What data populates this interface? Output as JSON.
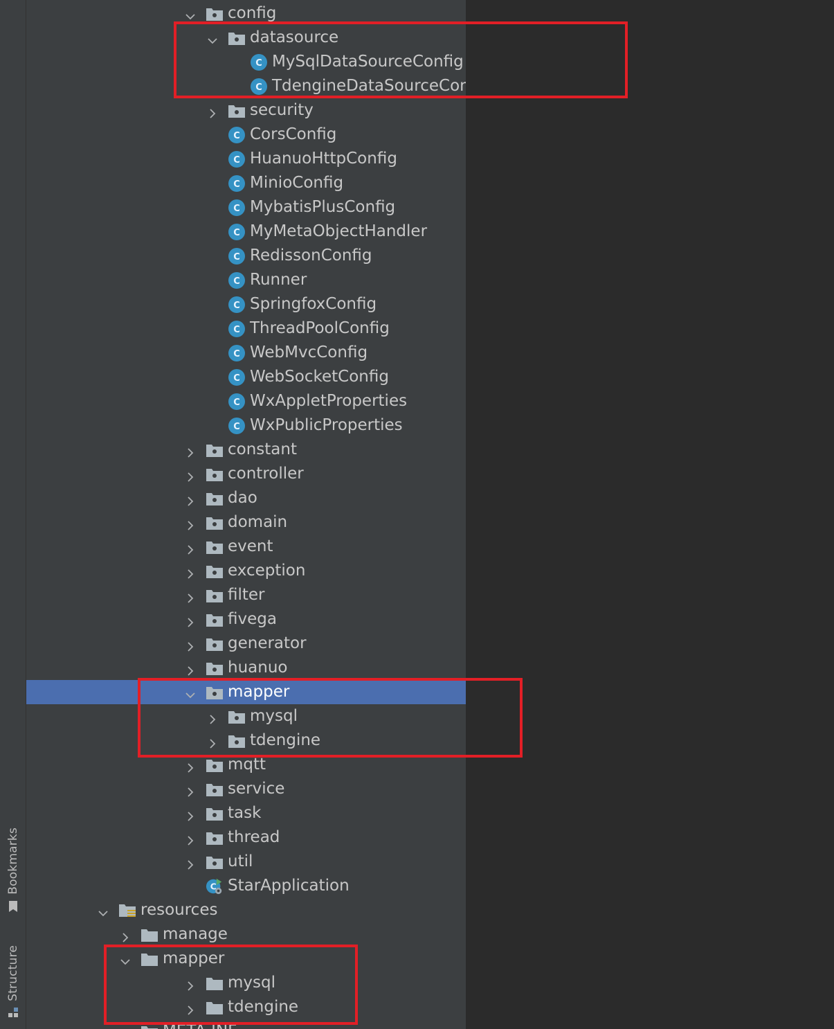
{
  "stripe": {
    "bookmarks_label": "Bookmarks",
    "structure_label": "Structure"
  },
  "tree": [
    {
      "label": "config",
      "type": "package",
      "expanded": true
    },
    {
      "label": "datasource",
      "type": "package",
      "expanded": true
    },
    {
      "label": "MySqlDataSourceConfig",
      "type": "class"
    },
    {
      "label": "TdengineDataSourceConfig",
      "type": "class"
    },
    {
      "label": "security",
      "type": "package",
      "expanded": false
    },
    {
      "label": "CorsConfig",
      "type": "class"
    },
    {
      "label": "HuanuoHttpConfig",
      "type": "class"
    },
    {
      "label": "MinioConfig",
      "type": "class"
    },
    {
      "label": "MybatisPlusConfig",
      "type": "class"
    },
    {
      "label": "MyMetaObjectHandler",
      "type": "class"
    },
    {
      "label": "RedissonConfig",
      "type": "class"
    },
    {
      "label": "Runner",
      "type": "class"
    },
    {
      "label": "SpringfoxConfig",
      "type": "class"
    },
    {
      "label": "ThreadPoolConfig",
      "type": "class"
    },
    {
      "label": "WebMvcConfig",
      "type": "class"
    },
    {
      "label": "WebSocketConfig",
      "type": "class"
    },
    {
      "label": "WxAppletProperties",
      "type": "class"
    },
    {
      "label": "WxPublicProperties",
      "type": "class"
    },
    {
      "label": "constant",
      "type": "package",
      "expanded": false
    },
    {
      "label": "controller",
      "type": "package",
      "expanded": false
    },
    {
      "label": "dao",
      "type": "package",
      "expanded": false
    },
    {
      "label": "domain",
      "type": "package",
      "expanded": false
    },
    {
      "label": "event",
      "type": "package",
      "expanded": false
    },
    {
      "label": "exception",
      "type": "package",
      "expanded": false
    },
    {
      "label": "filter",
      "type": "package",
      "expanded": false
    },
    {
      "label": "fivega",
      "type": "package",
      "expanded": false
    },
    {
      "label": "generator",
      "type": "package",
      "expanded": false
    },
    {
      "label": "huanuo",
      "type": "package",
      "expanded": false
    },
    {
      "label": "mapper",
      "type": "package",
      "expanded": true,
      "selected": true
    },
    {
      "label": "mysql",
      "type": "package",
      "expanded": false
    },
    {
      "label": "tdengine",
      "type": "package",
      "expanded": false
    },
    {
      "label": "mqtt",
      "type": "package",
      "expanded": false
    },
    {
      "label": "service",
      "type": "package",
      "expanded": false
    },
    {
      "label": "task",
      "type": "package",
      "expanded": false
    },
    {
      "label": "thread",
      "type": "package",
      "expanded": false
    },
    {
      "label": "util",
      "type": "package",
      "expanded": false
    },
    {
      "label": "StarApplication",
      "type": "app-class"
    },
    {
      "label": "resources",
      "type": "resources-folder",
      "expanded": true
    },
    {
      "label": "manage",
      "type": "folder",
      "expanded": false
    },
    {
      "label": "mapper",
      "type": "folder",
      "expanded": true
    },
    {
      "label": "mysql",
      "type": "folder",
      "expanded": false
    },
    {
      "label": "tdengine",
      "type": "folder",
      "expanded": false
    },
    {
      "label": "META-INF",
      "type": "folder",
      "expanded": false
    }
  ],
  "colors": {
    "panel_bg": "#3c3f41",
    "editor_bg": "#2b2b2b",
    "selection": "#4b6eaf",
    "highlight_box": "#e21f26",
    "class_icon": "#3592c4",
    "folder_icon": "#aeb9c0"
  }
}
